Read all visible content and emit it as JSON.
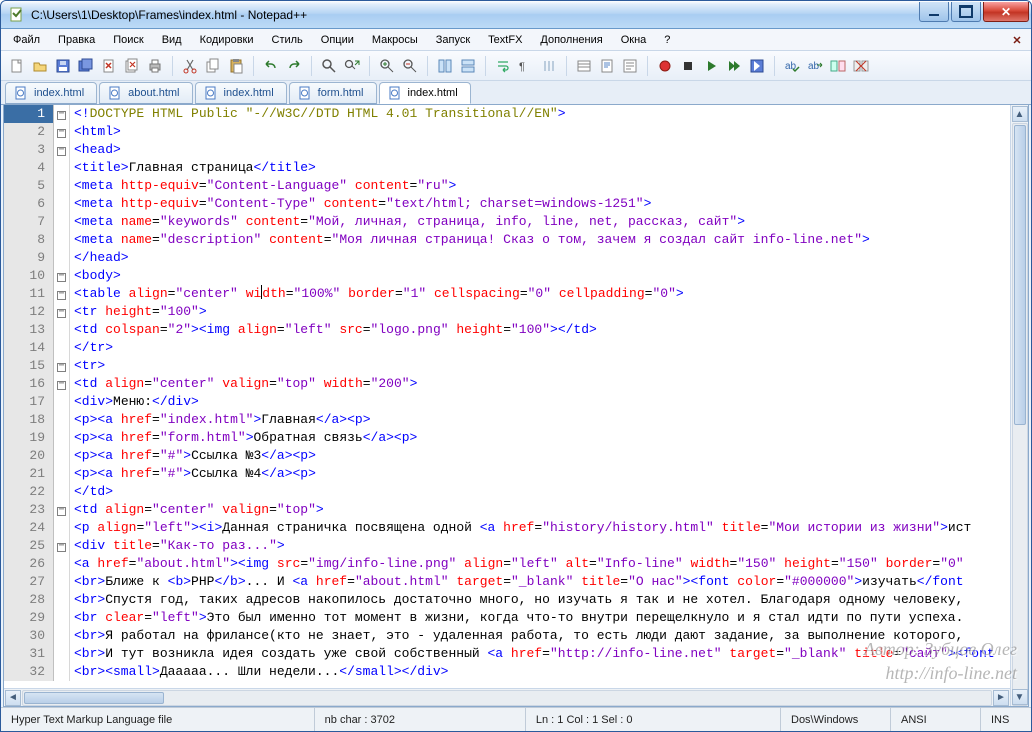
{
  "window": {
    "title": "C:\\Users\\1\\Desktop\\Frames\\index.html - Notepad++"
  },
  "menu": {
    "items": [
      "Файл",
      "Правка",
      "Поиск",
      "Вид",
      "Кодировки",
      "Стиль",
      "Опции",
      "Макросы",
      "Запуск",
      "TextFX",
      "Дополнения",
      "Окна",
      "?"
    ]
  },
  "tabs": [
    {
      "label": "index.html",
      "active": false
    },
    {
      "label": "about.html",
      "active": false
    },
    {
      "label": "index.html",
      "active": false
    },
    {
      "label": "form.html",
      "active": false
    },
    {
      "label": "index.html",
      "active": true
    }
  ],
  "toolbar_icons": [
    "new-file-icon",
    "open-file-icon",
    "save-icon",
    "save-all-icon",
    "close-icon",
    "close-all-icon",
    "print-icon",
    "sep",
    "cut-icon",
    "copy-icon",
    "paste-icon",
    "sep",
    "undo-icon",
    "redo-icon",
    "sep",
    "find-icon",
    "replace-icon",
    "sep",
    "zoom-in-icon",
    "zoom-out-icon",
    "sep",
    "sync-v-icon",
    "sync-h-icon",
    "sep",
    "word-wrap-icon",
    "show-all-chars-icon",
    "indent-guide-icon",
    "sep",
    "folder-icon",
    "doc-map-icon",
    "function-list-icon",
    "sep",
    "record-macro-icon",
    "stop-macro-icon",
    "play-macro-icon",
    "play-multi-icon",
    "save-macro-icon",
    "sep",
    "spellcheck-icon",
    "spellcheck-next-icon",
    "compare-icon",
    "clear-compare-icon"
  ],
  "status": {
    "type": "Hyper Text Markup Language file",
    "nbchar": "nb char : 3702",
    "pos": "Ln : 1   Col : 1   Sel : 0",
    "eol": "Dos\\Windows",
    "enc": "ANSI",
    "mode": "INS"
  },
  "watermark": {
    "l1": "Автор: Зубцов Олег",
    "l2": "http://info-line.net"
  },
  "lines": [
    {
      "n": 1,
      "fold": "box",
      "html": "<span class='tag'>&lt;!</span><span class='cmt'>DOCTYPE HTML Public \"-//W3C//DTD HTML 4.01 Transitional//EN\"</span><span class='tag'>&gt;</span>"
    },
    {
      "n": 2,
      "fold": "box",
      "html": "<span class='tag'>&lt;html&gt;</span>"
    },
    {
      "n": 3,
      "fold": "box",
      "html": "<span class='tag'>&lt;head&gt;</span>"
    },
    {
      "n": 4,
      "fold": "line",
      "html": "<span class='tag'>&lt;title&gt;</span><span class='txt'>Главная страница</span><span class='tag'>&lt;/title&gt;</span>"
    },
    {
      "n": 5,
      "fold": "line",
      "html": "<span class='tag'>&lt;meta</span> <span class='attr'>http-equiv</span>=<span class='str'>\"Content-Language\"</span> <span class='attr'>content</span>=<span class='str'>\"ru\"</span><span class='tag'>&gt;</span>"
    },
    {
      "n": 6,
      "fold": "line",
      "html": "<span class='tag'>&lt;meta</span> <span class='attr'>http-equiv</span>=<span class='str'>\"Content-Type\"</span> <span class='attr'>content</span>=<span class='str'>\"text/html; charset=windows-1251\"</span><span class='tag'>&gt;</span>"
    },
    {
      "n": 7,
      "fold": "line",
      "html": "<span class='tag'>&lt;meta</span> <span class='attr'>name</span>=<span class='str'>\"keywords\"</span> <span class='attr'>content</span>=<span class='str'>\"Мой, личная, страница, info, line, net, рассказ, сайт\"</span><span class='tag'>&gt;</span>"
    },
    {
      "n": 8,
      "fold": "line",
      "html": "<span class='tag'>&lt;meta</span> <span class='attr'>name</span>=<span class='str'>\"description\"</span> <span class='attr'>content</span>=<span class='str'>\"Моя личная страница! Сказ о том, зачем я создал сайт info-line.net\"</span><span class='tag'>&gt;</span>"
    },
    {
      "n": 9,
      "fold": "line",
      "html": "<span class='tag'>&lt;/head&gt;</span>"
    },
    {
      "n": 10,
      "fold": "box",
      "html": "<span class='tag'>&lt;body&gt;</span>"
    },
    {
      "n": 11,
      "fold": "box",
      "html": "<span class='tag'>&lt;table</span> <span class='attr'>align</span>=<span class='str'>\"center\"</span> <span class='attr'>wi<span class='cursor'></span>dth</span>=<span class='str'>\"100%\"</span> <span class='attr'>border</span>=<span class='str'>\"1\"</span> <span class='attr'>cellspacing</span>=<span class='str'>\"0\"</span> <span class='attr'>cellpadding</span>=<span class='str'>\"0\"</span><span class='tag'>&gt;</span>"
    },
    {
      "n": 12,
      "fold": "box",
      "html": "<span class='tag'>&lt;tr</span> <span class='attr'>height</span>=<span class='str'>\"100\"</span><span class='tag'>&gt;</span>"
    },
    {
      "n": 13,
      "fold": "line",
      "html": "<span class='tag'>&lt;td</span> <span class='attr'>colspan</span>=<span class='str'>\"2\"</span><span class='tag'>&gt;&lt;img</span> <span class='attr'>align</span>=<span class='str'>\"left\"</span> <span class='attr'>src</span>=<span class='str'>\"logo.png\"</span> <span class='attr'>height</span>=<span class='str'>\"100\"</span><span class='tag'>&gt;&lt;/td&gt;</span>"
    },
    {
      "n": 14,
      "fold": "line",
      "html": "<span class='tag'>&lt;/tr&gt;</span>"
    },
    {
      "n": 15,
      "fold": "box",
      "html": "<span class='tag'>&lt;tr&gt;</span>"
    },
    {
      "n": 16,
      "fold": "box",
      "html": "<span class='tag'>&lt;td</span> <span class='attr'>align</span>=<span class='str'>\"center\"</span> <span class='attr'>valign</span>=<span class='str'>\"top\"</span> <span class='attr'>width</span>=<span class='str'>\"200\"</span><span class='tag'>&gt;</span>"
    },
    {
      "n": 17,
      "fold": "line",
      "html": "<span class='tag'>&lt;div&gt;</span><span class='txt'>Меню:</span><span class='tag'>&lt;/div&gt;</span>"
    },
    {
      "n": 18,
      "fold": "line",
      "html": "<span class='tag'>&lt;p&gt;&lt;a</span> <span class='attr'>href</span>=<span class='str'>\"index.html\"</span><span class='tag'>&gt;</span><span class='txt'>Главная</span><span class='tag'>&lt;/a&gt;&lt;p&gt;</span>"
    },
    {
      "n": 19,
      "fold": "line",
      "html": "<span class='tag'>&lt;p&gt;&lt;a</span> <span class='attr'>href</span>=<span class='str'>\"form.html\"</span><span class='tag'>&gt;</span><span class='txt'>Обратная связь</span><span class='tag'>&lt;/a&gt;&lt;p&gt;</span>"
    },
    {
      "n": 20,
      "fold": "line",
      "html": "<span class='tag'>&lt;p&gt;&lt;a</span> <span class='attr'>href</span>=<span class='str'>\"#\"</span><span class='tag'>&gt;</span><span class='txt'>Ссылка №3</span><span class='tag'>&lt;/a&gt;&lt;p&gt;</span>"
    },
    {
      "n": 21,
      "fold": "line",
      "html": "<span class='tag'>&lt;p&gt;&lt;a</span> <span class='attr'>href</span>=<span class='str'>\"#\"</span><span class='tag'>&gt;</span><span class='txt'>Ссылка №4</span><span class='tag'>&lt;/a&gt;&lt;p&gt;</span>"
    },
    {
      "n": 22,
      "fold": "line",
      "html": "<span class='tag'>&lt;/td&gt;</span>"
    },
    {
      "n": 23,
      "fold": "box",
      "html": "<span class='tag'>&lt;td</span> <span class='attr'>align</span>=<span class='str'>\"center\"</span> <span class='attr'>valign</span>=<span class='str'>\"top\"</span><span class='tag'>&gt;</span>"
    },
    {
      "n": 24,
      "fold": "line",
      "html": "<span class='tag'>&lt;p</span> <span class='attr'>align</span>=<span class='str'>\"left\"</span><span class='tag'>&gt;&lt;i&gt;</span><span class='txt'>Данная страничка посвящена одной </span><span class='tag'>&lt;a</span> <span class='attr'>href</span>=<span class='str'>\"history/history.html\"</span> <span class='attr'>title</span>=<span class='str'>\"Мои истории из жизни\"</span><span class='tag'>&gt;</span><span class='txt'>ист</span>"
    },
    {
      "n": 25,
      "fold": "box",
      "html": "<span class='tag'>&lt;div</span> <span class='attr'>title</span>=<span class='str'>\"Как-то раз...\"</span><span class='tag'>&gt;</span>"
    },
    {
      "n": 26,
      "fold": "line",
      "html": "<span class='tag'>&lt;a</span> <span class='attr'>href</span>=<span class='str'>\"about.html\"</span><span class='tag'>&gt;&lt;img</span> <span class='attr'>src</span>=<span class='str'>\"img/info-line.png\"</span> <span class='attr'>align</span>=<span class='str'>\"left\"</span> <span class='attr'>alt</span>=<span class='str'>\"Info-line\"</span> <span class='attr'>width</span>=<span class='str'>\"150\"</span> <span class='attr'>height</span>=<span class='str'>\"150\"</span> <span class='attr'>border</span>=<span class='str'>\"0\"</span>"
    },
    {
      "n": 27,
      "fold": "line",
      "html": "<span class='tag'>&lt;br&gt;</span><span class='txt'>Ближе к </span><span class='tag'>&lt;b&gt;</span><span class='txt'>PHP</span><span class='tag'>&lt;/b&gt;</span><span class='txt'>... И </span><span class='tag'>&lt;a</span> <span class='attr'>href</span>=<span class='str'>\"about.html\"</span> <span class='attr'>target</span>=<span class='str'>\"_blank\"</span> <span class='attr'>title</span>=<span class='str'>\"О нас\"</span><span class='tag'>&gt;&lt;font</span> <span class='attr'>color</span>=<span class='str'>\"#000000\"</span><span class='tag'>&gt;</span><span class='txt'>изучать</span><span class='tag'>&lt;/font</span>"
    },
    {
      "n": 28,
      "fold": "line",
      "html": "<span class='tag'>&lt;br&gt;</span><span class='txt'>Спустя год, таких адресов накопилось достаточно много, но изучать я так и не хотел. Благодаря одному человеку,</span>"
    },
    {
      "n": 29,
      "fold": "line",
      "html": "<span class='tag'>&lt;br</span> <span class='attr'>clear</span>=<span class='str'>\"left\"</span><span class='tag'>&gt;</span><span class='txt'>Это был именно тот момент в жизни, когда что-то внутри перещелкнуло и я стал идти по пути успеха.</span>"
    },
    {
      "n": 30,
      "fold": "line",
      "html": "<span class='tag'>&lt;br&gt;</span><span class='txt'>Я работал на фрилансе(кто не знает, это - удаленная работа, то есть люди дают задание, за выполнение которого,</span>"
    },
    {
      "n": 31,
      "fold": "line",
      "html": "<span class='tag'>&lt;br&gt;</span><span class='txt'>И тут возникла идея создать уже свой собственный </span><span class='tag'>&lt;a</span> <span class='attr'>href</span>=<span class='str'>\"http://info-line.net\"</span> <span class='attr'>target</span>=<span class='str'>\"_blank\"</span> <span class='attr'>title</span>=<span class='str'>\"сайт\"</span><span class='tag'>&gt;&lt;font</span>"
    },
    {
      "n": 32,
      "fold": "line",
      "html": "<span class='tag'>&lt;br&gt;&lt;small&gt;</span><span class='txt'>Дааааа... Шли недели...</span><span class='tag'>&lt;/small&gt;&lt;/div&gt;</span>"
    }
  ]
}
